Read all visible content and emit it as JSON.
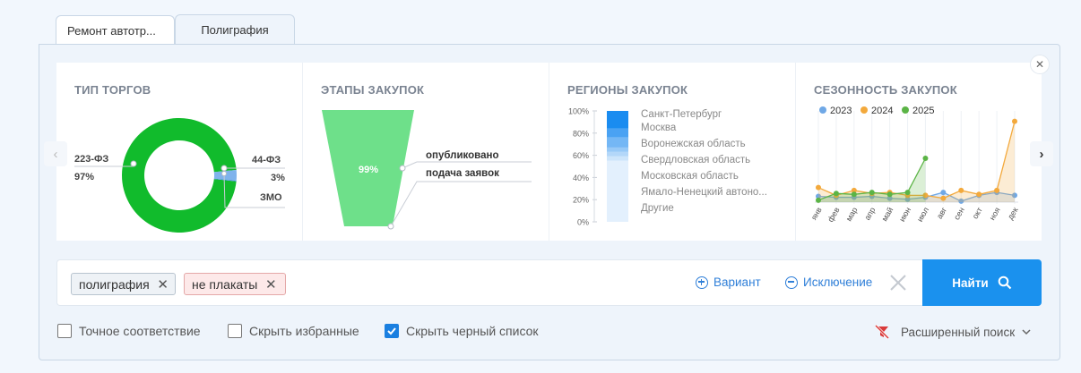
{
  "tabs": [
    {
      "label": "Ремонт автотр..."
    },
    {
      "label": "Полиграфия"
    }
  ],
  "cards": {
    "trade_type": {
      "title": "ТИП ТОРГОВ",
      "labels": {
        "left_name": "223-ФЗ",
        "left_pct": "97%",
        "right_name": "44-ФЗ",
        "right_pct": "3%",
        "small": "ЗМО"
      }
    },
    "stages": {
      "title": "ЭТАПЫ ЗАКУПОК",
      "center_pct": "99%",
      "labels": [
        "опубликовано",
        "подача заявок"
      ]
    },
    "regions": {
      "title": "РЕГИОНЫ ЗАКУПОК",
      "axis": [
        "100%",
        "80%",
        "60%",
        "40%",
        "20%",
        "0%"
      ],
      "items": [
        "Санкт-Петербург",
        "Москва",
        "Воронежская область",
        "Свердловская область",
        "Московская область",
        "Ямало-Ненецкий автоно...",
        "Другие"
      ]
    },
    "season": {
      "title": "СЕЗОННОСТЬ ЗАКУПОК"
    }
  },
  "chart_data": [
    {
      "type": "pie",
      "title": "ТИП ТОРГОВ",
      "categories": [
        "223-ФЗ",
        "44-ФЗ",
        "ЗМО"
      ],
      "values": [
        97,
        3,
        0.2
      ]
    },
    {
      "type": "bar",
      "title": "ЭТАПЫ ЗАКУПОК",
      "categories": [
        "опубликовано",
        "подача заявок"
      ],
      "values": [
        99,
        1
      ]
    },
    {
      "type": "bar",
      "title": "РЕГИОНЫ ЗАКУПОК",
      "ylim": [
        0,
        100
      ],
      "categories": [
        "Санкт-Петербург",
        "Москва",
        "Воронежская область",
        "Свердловская область",
        "Московская область",
        "Ямало-Ненецкий автоно...",
        "Другие"
      ],
      "values": [
        16,
        8,
        9,
        4,
        4,
        4,
        55
      ],
      "colors": [
        "#1a8cf0",
        "#4aa2f3",
        "#74b7f5",
        "#97c9f7",
        "#b3d7f9",
        "#cde5fb",
        "#e3f0fd"
      ]
    },
    {
      "type": "area",
      "title": "СЕЗОННОСТЬ ЗАКУПОК",
      "categories": [
        "янв",
        "фев",
        "мар",
        "апр",
        "май",
        "июн",
        "июл",
        "авг",
        "сен",
        "окт",
        "ноя",
        "дек"
      ],
      "series": [
        {
          "name": "2023",
          "color": "#6fa8e6",
          "values": [
            6,
            5,
            5,
            6,
            4,
            3,
            5,
            10,
            1,
            7,
            10,
            7
          ]
        },
        {
          "name": "2024",
          "color": "#f3a93c",
          "values": [
            15,
            7,
            12,
            9,
            10,
            7,
            7,
            4,
            12,
            8,
            12,
            83
          ]
        },
        {
          "name": "2025",
          "color": "#5bb446",
          "values": [
            2,
            9,
            8,
            10,
            8,
            10,
            45,
            null,
            null,
            null,
            null,
            null
          ]
        }
      ]
    }
  ],
  "search": {
    "chips": [
      {
        "label": "полиграфия",
        "type": "include"
      },
      {
        "label": "не плакаты",
        "type": "exclude"
      }
    ],
    "variant_label": "Вариант",
    "exclude_label": "Исключение",
    "find_label": "Найти"
  },
  "options": {
    "exact": "Точное соответствие",
    "hide_fav": "Скрыть избранные",
    "hide_black": "Скрыть черный список",
    "advanced": "Расширенный поиск"
  }
}
